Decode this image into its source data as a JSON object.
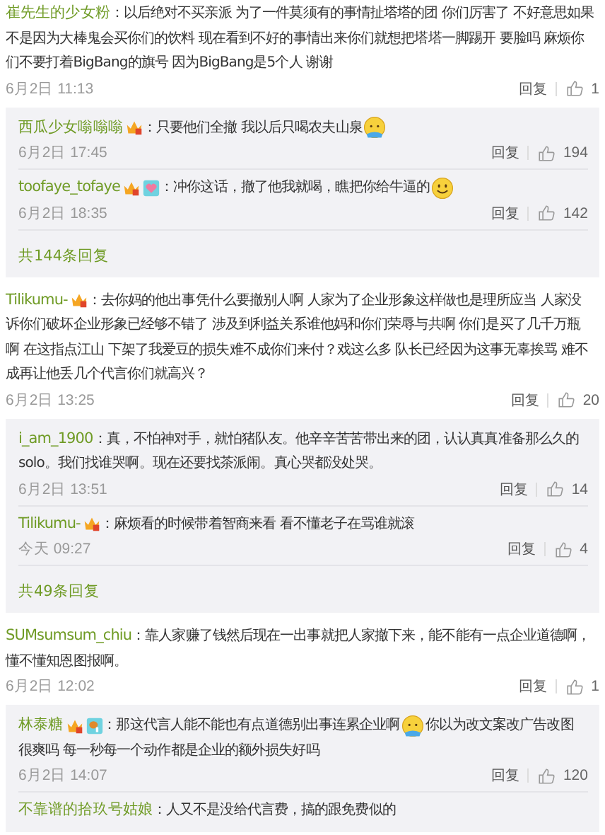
{
  "comments": [
    {
      "user": "崔先生的少女粉",
      "lines": [
        [
          {
            "kind": "text",
            "text": "：以后绝对不买亲派 为了一件莫须有的事情扯塔塔的团 你们厉害了 不好意思如果"
          }
        ],
        [
          {
            "kind": "text",
            "text": "不是因为大棒鬼会买你们的饮料 现在看到不好的事情出来你们就想把塔塔一脚踢开 要脸吗 麻烦你"
          }
        ],
        [
          {
            "kind": "text",
            "text": "们不要打着BigBang的旗号 因为BigBang是5个人 谢谢"
          }
        ]
      ],
      "time": "6月2日 11:13",
      "reply_label": "回复",
      "likes": "1",
      "replies": [
        {
          "user": "西瓜少女嗡嗡嗡",
          "badges": [
            {
              "kind": "crown"
            }
          ],
          "lines": [
            [
              {
                "kind": "text",
                "text": "：只要他们全撤 我以后只喝农夫山泉"
              },
              {
                "kind": "shyface"
              }
            ]
          ],
          "time": "6月2日 17:45",
          "reply_label": "回复",
          "likes": "194"
        },
        {
          "user": "toofaye_tofaye",
          "badges": [
            {
              "kind": "crown"
            },
            {
              "kind": "heart"
            }
          ],
          "lines": [
            [
              {
                "kind": "text",
                "text": "：冲你这话，撤了他我就喝，瞧把你给牛逼的"
              },
              {
                "kind": "smiley"
              }
            ]
          ],
          "time": "6月2日 18:35",
          "reply_label": "回复",
          "likes": "142"
        }
      ],
      "more": "共144条回复"
    },
    {
      "user": "Tilikumu-",
      "badges": [
        {
          "kind": "crown"
        }
      ],
      "lines": [
        [
          {
            "kind": "text",
            "text": "：去你妈的他出事凭什么要撤别人啊 人家为了企业形象这样做也是理所应当 人家没"
          }
        ],
        [
          {
            "kind": "text",
            "text": "诉你们破坏企业形象已经够不错了 涉及到利益关系谁他妈和你们荣辱与共啊 你们是买了几千万瓶"
          }
        ],
        [
          {
            "kind": "text",
            "text": "啊 在这指点江山 下架了我爱豆的损失难不成你们来付？戏这么多 队长已经因为这事无辜挨骂 难不"
          }
        ],
        [
          {
            "kind": "text",
            "text": "成再让他丢几个代言你们就高兴？"
          }
        ]
      ],
      "time": "6月2日 13:25",
      "reply_label": "回复",
      "likes": "20",
      "replies": [
        {
          "user": "i_am_1900",
          "lines": [
            [
              {
                "kind": "text",
                "text": "：真，不怕神对手，就怕猪队友。他辛辛苦苦带出来的团，认认真真准备那么久的"
              }
            ],
            [
              {
                "kind": "text",
                "text": "solo。我们找谁哭啊。现在还要找茶派闹。真心哭都没处哭。"
              }
            ]
          ],
          "time": "6月2日 13:51",
          "reply_label": "回复",
          "likes": "14"
        },
        {
          "user": "Tilikumu-",
          "badges": [
            {
              "kind": "crown"
            }
          ],
          "lines": [
            [
              {
                "kind": "text",
                "text": "：麻烦看的时候带着智商来看 看不懂老子在骂谁就滚"
              }
            ]
          ],
          "time": "今天 09:27",
          "reply_label": "回复",
          "likes": "4"
        }
      ],
      "more": "共49条回复"
    },
    {
      "user": "SUMsumsum_chiu",
      "lines": [
        [
          {
            "kind": "text",
            "text": "：靠人家赚了钱然后现在一出事就把人家撤下来，能不能有一点企业道德啊，"
          }
        ],
        [
          {
            "kind": "text",
            "text": "懂不懂知恩图报啊。"
          }
        ]
      ],
      "time": "6月2日 12:02",
      "reply_label": "回复",
      "likes": "1",
      "replies": [
        {
          "user": "林泰糖",
          "badges": [
            {
              "kind": "crown"
            },
            {
              "kind": "drumstick"
            }
          ],
          "lines": [
            [
              {
                "kind": "text",
                "text": "：那这代言人能不能也有点道德别出事连累企业啊"
              },
              {
                "kind": "shyface"
              },
              {
                "kind": "text",
                "text": "你以为改文案改广告改图"
              }
            ],
            [
              {
                "kind": "text",
                "text": "很爽吗 每一秒每一个动作都是企业的额外损失好吗"
              }
            ]
          ],
          "time": "6月2日 14:07",
          "reply_label": "回复",
          "likes": "120"
        },
        {
          "user": "不靠谱的拾玖号姑娘",
          "lines": [
            [
              {
                "kind": "text",
                "text": "：人又不是没给代言费，搞的跟免费似的"
              }
            ]
          ]
        }
      ]
    }
  ]
}
